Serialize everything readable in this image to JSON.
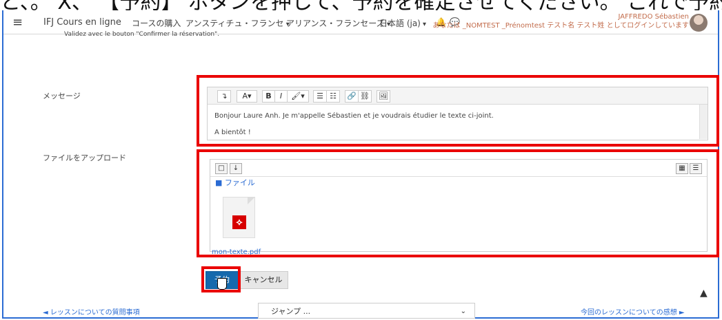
{
  "top_caption": "と、。 X、 【予約】 ボタンを押して、予約を確定させてください。 これで予約",
  "header": {
    "brand": "IFJ Cours en ligne",
    "menu": [
      "コースの購入",
      "アンスティチュ・フランセ",
      "アリアンス・フランセーズ",
      "日本語 (ja)"
    ],
    "user_name": "JAFFREDO Sébastien",
    "user_status": "あなたは _NOMTEST _Prénomtest テスト名 テスト姓 としてログインしています"
  },
  "instruction": "Validez avec le bouton \"Confirmer la réservation\".",
  "message": {
    "label": "メッセージ",
    "toolbar": [
      "↴",
      "A▾",
      "B",
      "I",
      "🖌▾",
      "☰",
      "☷",
      "🔗",
      "⛓",
      "🖼"
    ],
    "text_line1": "Bonjour Laure Anh. Je m'appelle Sébastien et je voudrais étudier le texte ci-joint.",
    "text_line2": "A bientôt !"
  },
  "upload": {
    "label": "ファイルをアップロード",
    "folder": "ファイル",
    "filename": "mon-texte.pdf"
  },
  "buttons": {
    "submit": "予約",
    "cancel": "キャンセル"
  },
  "footer": {
    "previous": "◄ レッスンについての質問事項",
    "jump": "ジャンプ ...",
    "next": "今回のレッスンについての感想 ►"
  },
  "colors": {
    "accent_blue": "#1569ad",
    "highlight_red": "#ea0000"
  }
}
